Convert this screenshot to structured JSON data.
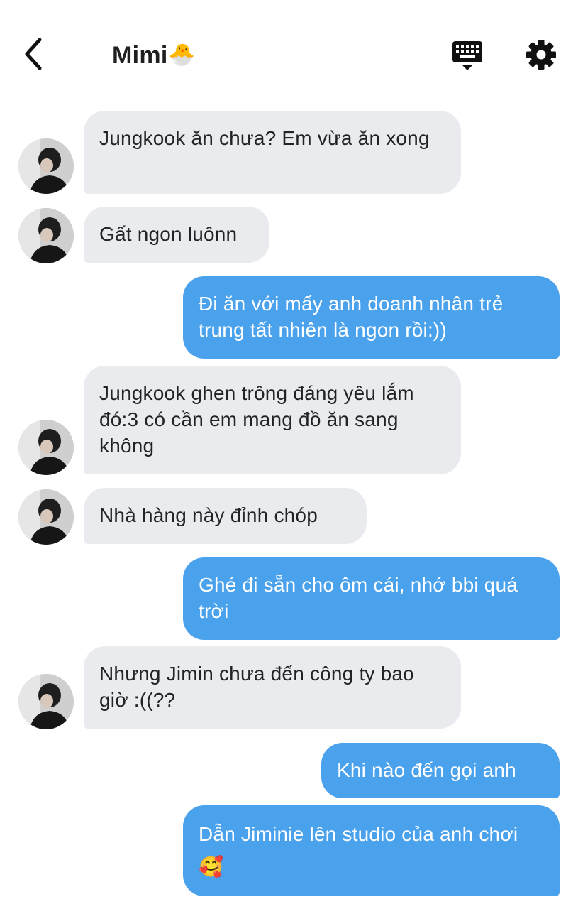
{
  "header": {
    "title": "Mimi",
    "title_emoji": "🐣",
    "back_icon": "chevron-left-icon",
    "keyboard_icon": "keyboard-icon",
    "settings_icon": "gear-icon"
  },
  "messages": [
    {
      "direction": "incoming",
      "text": "Jungkook ăn chưa? Em vừa ăn xong"
    },
    {
      "direction": "incoming",
      "text": "Gất ngon luônn"
    },
    {
      "direction": "outgoing",
      "text": "Đi ăn với mấy anh doanh nhân trẻ trung tất nhiên là ngon rồi:))"
    },
    {
      "direction": "incoming",
      "text": "Jungkook ghen trông đáng yêu lắm đó:3 có cần em mang đồ ăn sang không"
    },
    {
      "direction": "incoming",
      "text": "Nhà hàng này đỉnh chóp"
    },
    {
      "direction": "outgoing",
      "text": "Ghé đi sẵn cho ôm cái, nhớ bbi quá trời"
    },
    {
      "direction": "incoming",
      "text": "Nhưng Jimin chưa đến công ty bao giờ :((??"
    },
    {
      "direction": "outgoing",
      "text": "Khi nào đến gọi anh"
    },
    {
      "direction": "outgoing",
      "text": "Dẫn Jiminie lên studio của anh chơi",
      "emoji": "🥰"
    }
  ],
  "colors": {
    "incoming_bubble": "#e9ebef",
    "outgoing_bubble": "#4aa1ec",
    "text_dark": "#222326",
    "text_light": "#ffffff"
  }
}
